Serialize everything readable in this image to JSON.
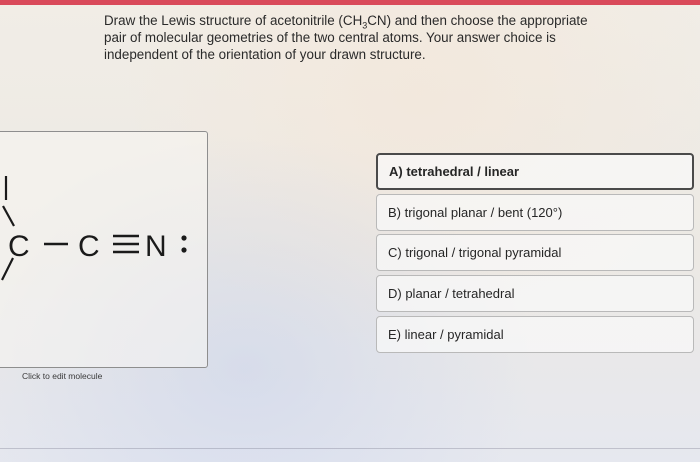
{
  "question": {
    "text_1": "Draw the Lewis structure of acetonitrile (CH",
    "sub": "3",
    "text_2": "CN) and then choose the appropriate pair of molecular geometries of the two central atoms. Your answer choice is independent of the orientation of your drawn structure."
  },
  "editor": {
    "atom_c1": "C",
    "atom_c2": "C",
    "atom_n": "N",
    "edit_label": "Click to edit molecule"
  },
  "choices": [
    {
      "label": "A) tetrahedral / linear",
      "selected": true
    },
    {
      "label": "B) trigonal planar / bent (120°)",
      "selected": false
    },
    {
      "label": "C) trigonal / trigonal pyramidal",
      "selected": false
    },
    {
      "label": "D) planar / tetrahedral",
      "selected": false
    },
    {
      "label": "E) linear / pyramidal",
      "selected": false
    }
  ],
  "colors": {
    "top_bar": "#d94a5a",
    "text": "#2a2a2a"
  }
}
